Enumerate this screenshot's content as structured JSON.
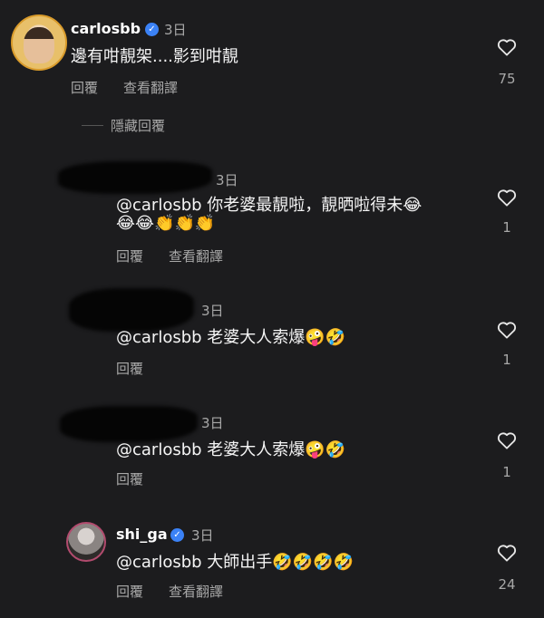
{
  "comments": [
    {
      "username": "carlosbb",
      "time": "3日",
      "text": "邊有咁靚架....影到咁靚",
      "reply": "回覆",
      "translate": "查看翻譯",
      "likes": "75"
    },
    {
      "time": "3日",
      "text": "@carlosbb 你老婆最靚啦，靚晒啦得未😂",
      "text2": "😂😂👏👏👏",
      "reply": "回覆",
      "translate": "查看翻譯",
      "likes": "1"
    },
    {
      "time": "3日",
      "text": "@carlosbb 老婆大人索爆🤪🤣",
      "reply": "回覆",
      "likes": "1"
    },
    {
      "time": "3日",
      "text": "@carlosbb 老婆大人索爆🤪🤣",
      "reply": "回覆",
      "likes": "1"
    },
    {
      "username": "shi_ga",
      "time": "3日",
      "text": "@carlosbb 大師出手🤣🤣🤣🤣",
      "reply": "回覆",
      "translate": "查看翻譯",
      "likes": "24"
    }
  ],
  "hide_replies": "隱藏回覆",
  "icons": {
    "heart": "heart-outline-icon",
    "verified": "verified-badge-icon"
  },
  "colors": {
    "background": "#1c1c1e",
    "verified": "#3b82f6",
    "muted": "#a8a8a8"
  }
}
